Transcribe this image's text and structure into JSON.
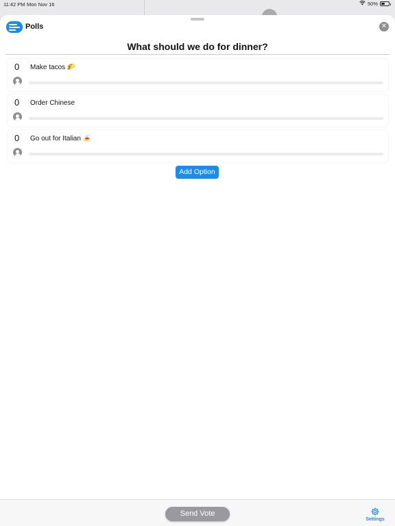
{
  "status_bar": {
    "time": "11:42 PM",
    "date": "Mon Nov 16",
    "battery": "50%"
  },
  "app": {
    "title": "Polls",
    "close_symbol": "✕"
  },
  "poll": {
    "question": "What should we do for dinner?",
    "options": [
      {
        "count": "0",
        "label": "Make tacos 🌮",
        "progress": 0
      },
      {
        "count": "0",
        "label": "Order Chinese",
        "progress": 0
      },
      {
        "count": "0",
        "label": "Go out for Italian 🍝",
        "progress": 0
      }
    ],
    "add_option_label": "Add Option"
  },
  "toolbar": {
    "send_vote_label": "Send Vote",
    "settings_label": "Settings"
  },
  "colors": {
    "accent": "#1a8cf0",
    "button_disabled": "#9a9a9e"
  },
  "icons": {
    "app": "polls-app-icon",
    "close": "close-icon",
    "voter": "person-icon",
    "settings": "gear-icon",
    "wifi": "wifi-icon",
    "battery": "battery-icon"
  }
}
